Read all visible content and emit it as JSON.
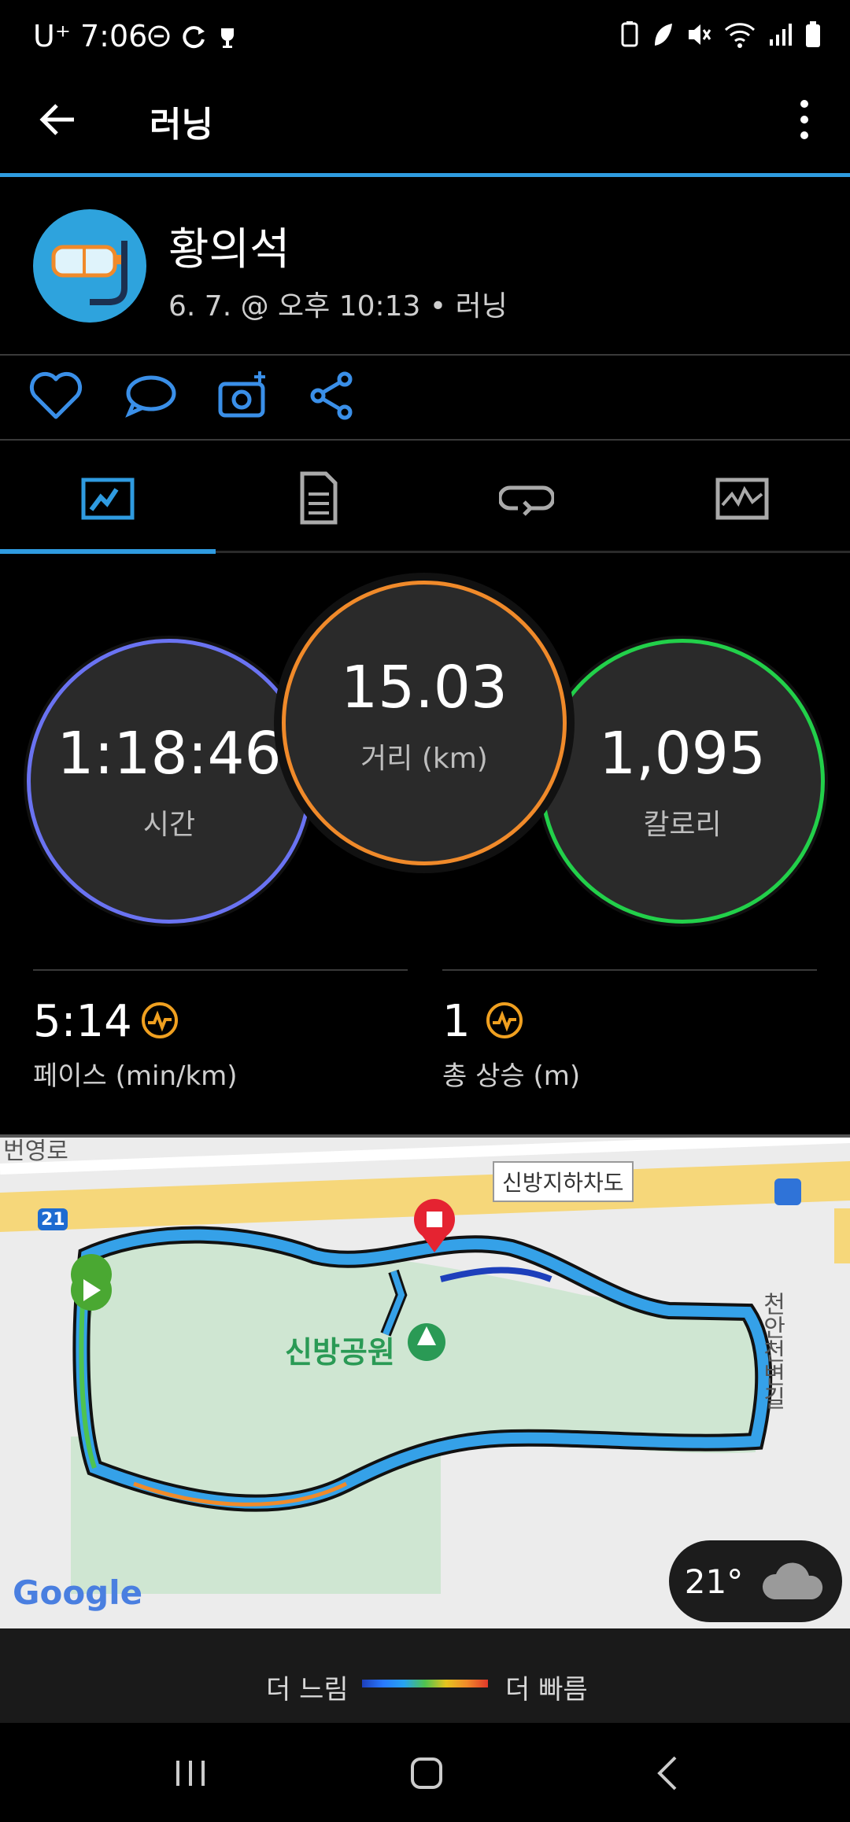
{
  "status_bar": {
    "carrier": "U⁺",
    "time": "7:06"
  },
  "header": {
    "title": "러닝"
  },
  "activity": {
    "user_name": "황의석",
    "meta": "6. 7. @ 오후 10:13 • 러닝"
  },
  "circles": {
    "time": {
      "value": "1:18:46",
      "label": "시간"
    },
    "distance": {
      "value": "15.03",
      "label": "거리 (km)"
    },
    "calories": {
      "value": "1,095",
      "label": "칼로리"
    }
  },
  "stats": {
    "pace": {
      "value": "5:14",
      "label": "페이스 (min/km)"
    },
    "ascent": {
      "value": "1",
      "label": "총 상승 (m)"
    }
  },
  "map": {
    "park_label": "신방공원",
    "underpass_label": "신방지하차도",
    "road_vertical": "천안천변길",
    "road_top_left": "번영로",
    "road_number": "21",
    "provider": "Google",
    "weather": "21°"
  },
  "legend": {
    "slow": "더 느림",
    "fast": "더 빠름"
  },
  "colors": {
    "accent": "#2f9be0",
    "time_ring": "#6a73f2",
    "distance_ring": "#f08a2a",
    "calorie_ring": "#22d04a"
  }
}
